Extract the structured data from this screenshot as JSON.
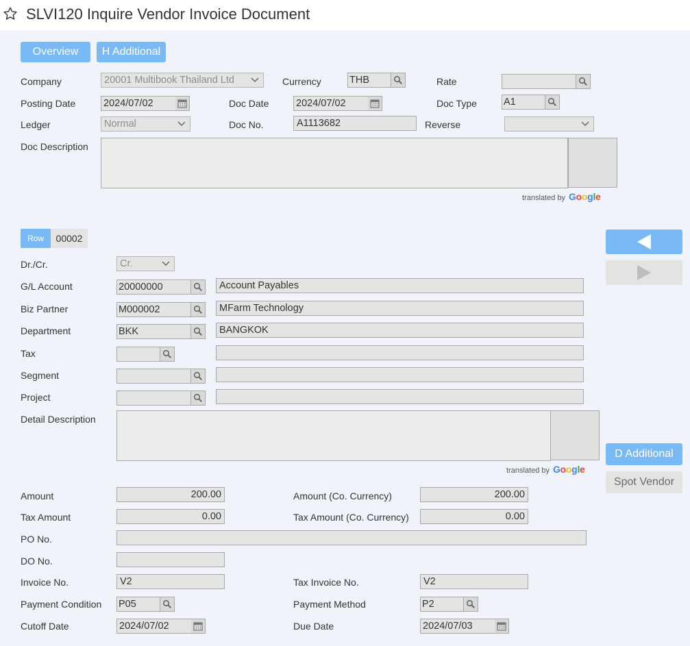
{
  "header": {
    "title": "SLVI120 Inquire Vendor Invoice Document"
  },
  "tabs": {
    "overview": "Overview",
    "h_additional": "H Additional"
  },
  "doc": {
    "company_label": "Company",
    "company_value": "20001 Multibook Thailand Ltd",
    "currency_label": "Currency",
    "currency_value": "THB",
    "rate_label": "Rate",
    "rate_value": "",
    "posting_date_label": "Posting Date",
    "posting_date_value": "2024/07/02",
    "doc_date_label": "Doc Date",
    "doc_date_value": "2024/07/02",
    "doc_type_label": "Doc Type",
    "doc_type_value": "A1",
    "ledger_label": "Ledger",
    "ledger_value": "Normal",
    "doc_no_label": "Doc No.",
    "doc_no_value": "A1113682",
    "reverse_label": "Reverse",
    "reverse_value": "",
    "doc_description_label": "Doc Description"
  },
  "google_translate": {
    "translated_by": "translated by",
    "google": "Google"
  },
  "row": {
    "tag": "Row",
    "number": "00002",
    "drcr_label": "Dr./Cr.",
    "drcr_value": "Cr.",
    "gl_account_label": "G/L Account",
    "gl_account_code": "20000000",
    "gl_account_name": "Account Payables",
    "biz_partner_label": "Biz Partner",
    "biz_partner_code": "M000002",
    "biz_partner_name": "MFarm Technology",
    "department_label": "Department",
    "department_code": "BKK",
    "department_name": "BANGKOK",
    "tax_label": "Tax",
    "tax_code": "",
    "tax_name": "",
    "segment_label": "Segment",
    "segment_code": "",
    "segment_name": "",
    "project_label": "Project",
    "project_code": "",
    "project_name": "",
    "detail_description_label": "Detail Description"
  },
  "amounts": {
    "amount_label": "Amount",
    "amount_value": "200.00",
    "amount_co_label": "Amount (Co. Currency)",
    "amount_co_value": "200.00",
    "tax_amount_label": "Tax Amount",
    "tax_amount_value": "0.00",
    "tax_amount_co_label": "Tax Amount (Co. Currency)",
    "tax_amount_co_value": "0.00",
    "po_no_label": "PO No.",
    "po_no_value": "",
    "do_no_label": "DO No.",
    "do_no_value": "",
    "invoice_no_label": "Invoice No.",
    "invoice_no_value": "V2",
    "tax_invoice_no_label": "Tax Invoice No.",
    "tax_invoice_no_value": "V2",
    "payment_condition_label": "Payment Condition",
    "payment_condition_value": "P05",
    "payment_method_label": "Payment Method",
    "payment_method_value": "P2",
    "cutoff_date_label": "Cutoff Date",
    "cutoff_date_value": "2024/07/02",
    "due_date_label": "Due Date",
    "due_date_value": "2024/07/03"
  },
  "side": {
    "d_additional": "D Additional",
    "spot_vendor": "Spot Vendor"
  },
  "colors": {
    "accent": "#79baf6",
    "field_bg": "#e4e4e4",
    "page_bg": "#f0f3f9"
  },
  "icons": [
    "star-icon",
    "search-icon",
    "calendar-icon",
    "chevron-down-icon",
    "arrow-left-icon",
    "arrow-right-icon"
  ]
}
